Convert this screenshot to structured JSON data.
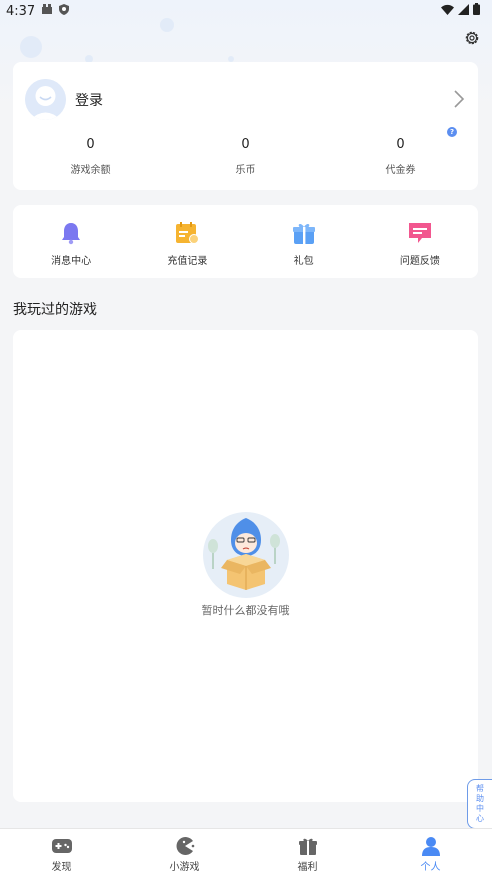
{
  "status_bar": {
    "time": "4:37"
  },
  "profile": {
    "login_label": "登录",
    "stats": [
      {
        "value": "0",
        "label": "游戏余额"
      },
      {
        "value": "0",
        "label": "乐币"
      },
      {
        "value": "0",
        "label": "代金券"
      }
    ],
    "help_mark": "?"
  },
  "menu": [
    {
      "label": "消息中心",
      "icon": "bell-icon"
    },
    {
      "label": "充值记录",
      "icon": "recharge-record-icon"
    },
    {
      "label": "礼包",
      "icon": "gift-icon"
    },
    {
      "label": "问题反馈",
      "icon": "feedback-icon"
    }
  ],
  "games_section": {
    "title": "我玩过的游戏",
    "empty_text": "暂时什么都没有哦"
  },
  "help_center": {
    "chars": [
      "帮",
      "助",
      "中",
      "心"
    ]
  },
  "tabs": [
    {
      "label": "发现",
      "icon": "gamepad-icon",
      "active": false
    },
    {
      "label": "小游戏",
      "icon": "pacman-icon",
      "active": false
    },
    {
      "label": "福利",
      "icon": "gift-box-icon",
      "active": false
    },
    {
      "label": "个人",
      "icon": "person-icon",
      "active": true
    }
  ],
  "colors": {
    "accent": "#4a8af4",
    "background": "#f4f5f7"
  }
}
